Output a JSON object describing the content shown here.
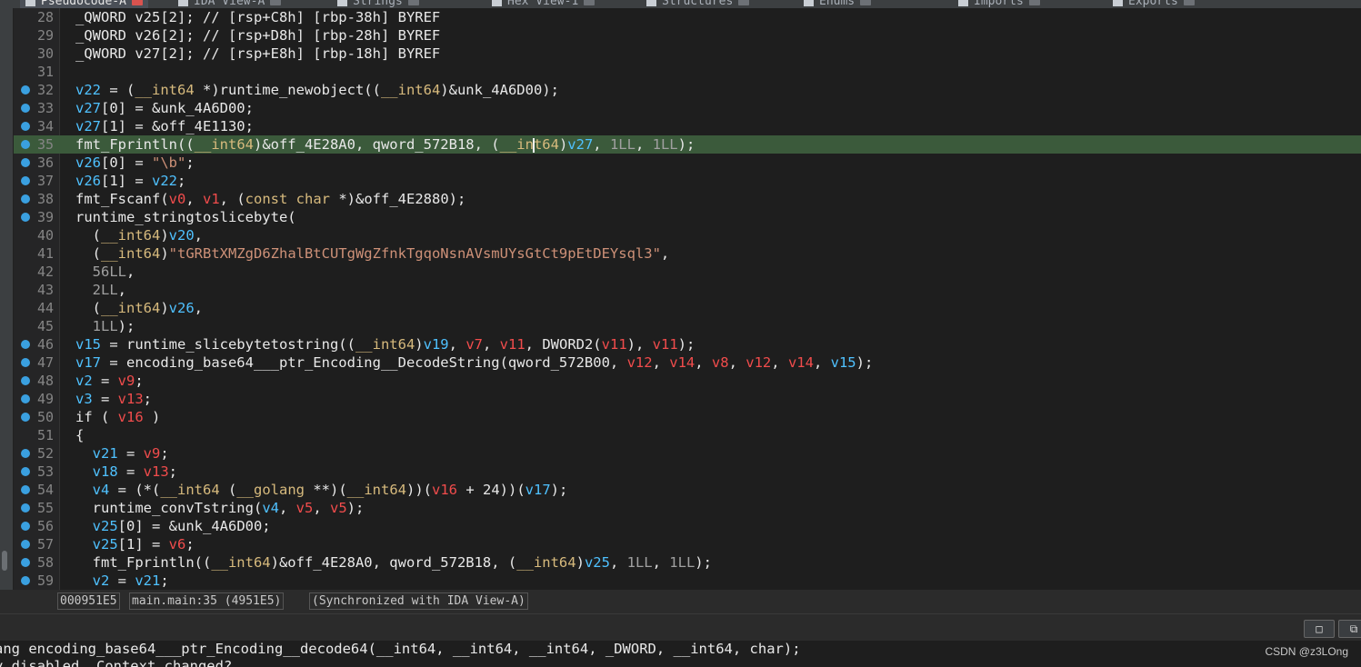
{
  "tabs": [
    {
      "label": "Pseudocode-A",
      "active": true
    },
    {
      "label": "IDA View-A",
      "active": false
    },
    {
      "label": "Strings",
      "active": false
    },
    {
      "label": "Hex View-1",
      "active": false
    },
    {
      "label": "Structures",
      "active": false
    },
    {
      "label": "Enums",
      "active": false
    },
    {
      "label": "Imports",
      "active": false
    },
    {
      "label": "Exports",
      "active": false
    }
  ],
  "code": {
    "lines": [
      {
        "n": "28",
        "dot": false,
        "t": "_QWORD v25[2]; // [rsp+C8h] [rbp-38h] BYREF"
      },
      {
        "n": "29",
        "dot": false,
        "t": "_QWORD v26[2]; // [rsp+D8h] [rbp-28h] BYREF"
      },
      {
        "n": "30",
        "dot": false,
        "t": "_QWORD v27[2]; // [rsp+E8h] [rbp-18h] BYREF"
      },
      {
        "n": "31",
        "dot": false,
        "t": ""
      },
      {
        "n": "32",
        "dot": true,
        "t": "v22 = (__int64 *)runtime_newobject((__int64)&unk_4A6D00);"
      },
      {
        "n": "33",
        "dot": true,
        "t": "v27[0] = &unk_4A6D00;"
      },
      {
        "n": "34",
        "dot": true,
        "t": "v27[1] = &off_4E1130;"
      },
      {
        "n": "35",
        "dot": true,
        "t": "fmt_Fprintln((__int64)&off_4E28A0, qword_572B18, (__int64)v27, 1LL, 1LL);",
        "hl": true
      },
      {
        "n": "36",
        "dot": true,
        "t": "v26[0] = \"\\b\";"
      },
      {
        "n": "37",
        "dot": true,
        "t": "v26[1] = v22;"
      },
      {
        "n": "38",
        "dot": true,
        "t": "fmt_Fscanf(v0, v1, (const char *)&off_4E2880);"
      },
      {
        "n": "39",
        "dot": true,
        "t": "runtime_stringtoslicebyte("
      },
      {
        "n": "40",
        "dot": false,
        "t": "  (__int64)v20,"
      },
      {
        "n": "41",
        "dot": false,
        "t": "  (__int64)\"tGRBtXMZgD6ZhalBtCUTgWgZfnkTgqoNsnAVsmUYsGtCt9pEtDEYsql3\","
      },
      {
        "n": "42",
        "dot": false,
        "t": "  56LL,"
      },
      {
        "n": "43",
        "dot": false,
        "t": "  2LL,"
      },
      {
        "n": "44",
        "dot": false,
        "t": "  (__int64)v26,"
      },
      {
        "n": "45",
        "dot": false,
        "t": "  1LL);"
      },
      {
        "n": "46",
        "dot": true,
        "t": "v15 = runtime_slicebytetostring((__int64)v19, v7, v11, DWORD2(v11), v11);"
      },
      {
        "n": "47",
        "dot": true,
        "t": "v17 = encoding_base64___ptr_Encoding__DecodeString(qword_572B00, v12, v14, v8, v12, v14, v15);"
      },
      {
        "n": "48",
        "dot": true,
        "t": "v2 = v9;"
      },
      {
        "n": "49",
        "dot": true,
        "t": "v3 = v13;"
      },
      {
        "n": "50",
        "dot": true,
        "t": "if ( v16 )"
      },
      {
        "n": "51",
        "dot": false,
        "t": "{"
      },
      {
        "n": "52",
        "dot": true,
        "t": "  v21 = v9;"
      },
      {
        "n": "53",
        "dot": true,
        "t": "  v18 = v13;"
      },
      {
        "n": "54",
        "dot": true,
        "t": "  v4 = (*(__int64 (__golang **)(__int64))(v16 + 24))(v17);"
      },
      {
        "n": "55",
        "dot": true,
        "t": "  runtime_convTstring(v4, v5, v5);"
      },
      {
        "n": "56",
        "dot": true,
        "t": "  v25[0] = &unk_4A6D00;"
      },
      {
        "n": "57",
        "dot": true,
        "t": "  v25[1] = v6;"
      },
      {
        "n": "58",
        "dot": true,
        "t": "  fmt_Fprintln((__int64)&off_4E28A0, qword_572B18, (__int64)v25, 1LL, 1LL);"
      },
      {
        "n": "59",
        "dot": true,
        "t": "  v2 = v21;"
      }
    ]
  },
  "status": {
    "address": "000951E5",
    "location": "main.main:35 (4951E5)",
    "sync": "(Synchronized with IDA View-A)"
  },
  "output": {
    "line1": "ang encoding_base64___ptr_Encoding__decode64(__int64, __int64, __int64, _DWORD, __int64, char);",
    "line2": "y disabled. Context changed?"
  },
  "watermark": "CSDN @z3LOng",
  "colors": {
    "highlight_row": "#3b5a3b",
    "breakpoint_dot": "#3aa0e0",
    "variable_blue": "#4fc1ff",
    "variable_red": "#f14c4c",
    "string": "#ce9178",
    "type_keyword": "#d7ba7d"
  }
}
